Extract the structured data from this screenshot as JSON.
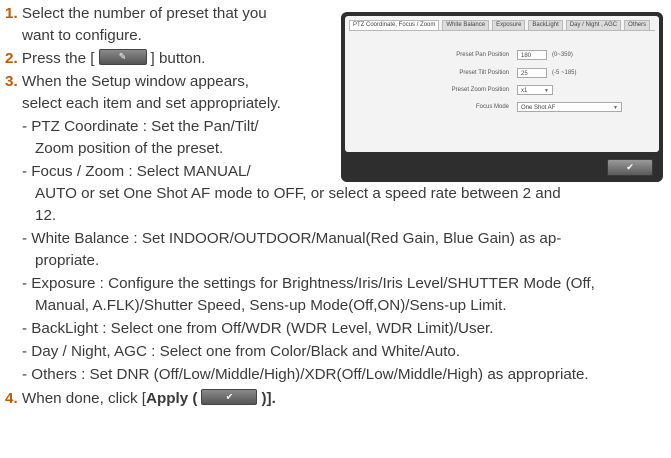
{
  "steps": {
    "s1": {
      "num": "1.",
      "line1": "Select the number of preset that you",
      "line2": "want to configure."
    },
    "s2": {
      "num": "2.",
      "pre": "Press the [",
      "post": "] button."
    },
    "s3": {
      "num": "3.",
      "line1": "When the Setup window appears,",
      "line2": "select each item and set appropriately."
    },
    "s4": {
      "num": "4.",
      "pre": "When done, click [",
      "bold": "Apply (",
      "post": ")]."
    }
  },
  "bullets": {
    "ptz": {
      "line1": "- PTZ Coordinate : Set the Pan/Tilt/",
      "line2": "Zoom position of the preset."
    },
    "focus": {
      "line1": "- Focus / Zoom : Select MANUAL/",
      "line2": "AUTO or set One Shot AF mode to OFF, or select a speed rate between 2 and",
      "line3": "12."
    },
    "wb": {
      "line1": "- White Balance : Set INDOOR/OUTDOOR/Manual(Red Gain, Blue Gain) as ap-",
      "line2": "propriate."
    },
    "exposure": {
      "line1": "- Exposure : Configure the settings for Brightness/Iris/Iris Level/SHUTTER Mode (Off,",
      "line2": "Manual, A.FLK)/Shutter Speed, Sens-up Mode(Off,ON)/Sens-up Limit."
    },
    "backlight": {
      "line1": "- BackLight : Select one from Off/WDR (WDR Level, WDR Limit)/User."
    },
    "daynight": {
      "line1": "- Day / Night, AGC : Select one from Color/Black and White/Auto."
    },
    "others": {
      "line1": "- Others : Set DNR (Off/Low/Middle/High)/XDR(Off/Low/Middle/High) as appropriate."
    }
  },
  "setup_window": {
    "tabs": [
      "PTZ Coordinate, Focus / Zoom",
      "White Balance",
      "Exposure",
      "BackLight",
      "Day / Night , AGC",
      "Others"
    ],
    "fields": {
      "pan": {
        "label": "Preset Pan Position",
        "value": "180",
        "range": "(0~359)"
      },
      "tilt": {
        "label": "Preset Tilt Position",
        "value": "25",
        "range": "(-5 ~185)"
      },
      "zoom": {
        "label": "Preset Zoom Position",
        "value": "x1"
      },
      "focus": {
        "label": "Focus Mode",
        "value": "One Shot AF"
      }
    }
  },
  "icons": {
    "set_button": "pencil-icon",
    "apply_button": "checkmark-icon"
  }
}
